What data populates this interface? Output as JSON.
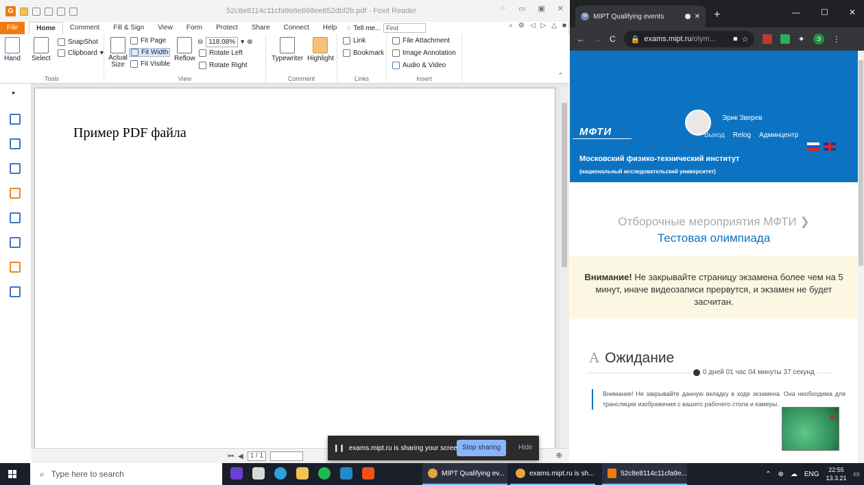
{
  "foxit": {
    "title": "52c8e8114c11cfa9e6e668ee652dbf2b.pdf - Foxit Reader",
    "tabs": [
      "File",
      "Home",
      "Comment",
      "Fill & Sign",
      "View",
      "Form",
      "Protect",
      "Share",
      "Connect",
      "Help"
    ],
    "tell_me": "Tell me...",
    "find_placeholder": "Find",
    "ribbon": {
      "hand": "Hand",
      "select": "Select",
      "snapshot": "SnapShot",
      "clipboard": "Clipboard",
      "tools_label": "Tools",
      "actual_size": "Actual Size",
      "fit_page": "Fit Page",
      "fit_width": "Fit Width",
      "fit_visible": "Fit Visible",
      "reflow": "Reflow",
      "zoom": "118.08%",
      "rotate_left": "Rotate Left",
      "rotate_right": "Rotate Right",
      "view_label": "View",
      "typewriter": "Typewriter",
      "highlight": "Highlight",
      "comment_label": "Comment",
      "link": "Link",
      "bookmark": "Bookmark",
      "links_label": "Links",
      "file_attachment": "File Attachment",
      "image_annotation": "Image Annotation",
      "audio_video": "Audio & Video",
      "insert_label": "Insert"
    },
    "page_text": "Пример PDF файла",
    "page_indicator": "1 / 1"
  },
  "share_bar": {
    "message": "exams.mipt.ru is sharing your screen.",
    "stop": "Stop sharing",
    "hide": "Hide"
  },
  "chrome": {
    "tab_title": "MIPT Qualifying events",
    "url_host": "exams.mipt.ru",
    "url_path": "/olym...",
    "profile_letter": "Э"
  },
  "site": {
    "logo": "МФТИ",
    "user_name": "Эрик Зверев",
    "links": [
      "Выход",
      "Relog",
      "Админцентр"
    ],
    "institute": "Московский физико-технический институт",
    "institute_sub": "(национальный исследовательский университет)",
    "crumb_parent": "Отборочные мероприятия МФТИ",
    "crumb_current": "Тестовая олимпиада",
    "warning_bold": "Внимание!",
    "warning_text": "Не закрывайте страницу экзамена более чем на 5 минут, иначе видеозаписи прервутся, и экзамен не будет засчитан.",
    "section_letter": "A",
    "section_title": "Ожидание",
    "timer": "0 дней 01 час 04 минуты 37 секунд",
    "note": "Внимание! Не закрывайте данную вкладку в ходе экзамена. Она необходима для трансляции изображения с вашего рабочего стола и камеры."
  },
  "taskbar": {
    "search_placeholder": "Type here to search",
    "apps": [
      "MIPT Qualifying ev...",
      "exams.mipt.ru is sh...",
      "52c8e8114c11cfa9e..."
    ],
    "lang": "ENG",
    "time": "22:55",
    "date": "13.3.21"
  },
  "colors": {
    "foxit_accent": "#f07a10",
    "mipt_blue": "#0c73c2",
    "chrome_dark": "#202124"
  }
}
